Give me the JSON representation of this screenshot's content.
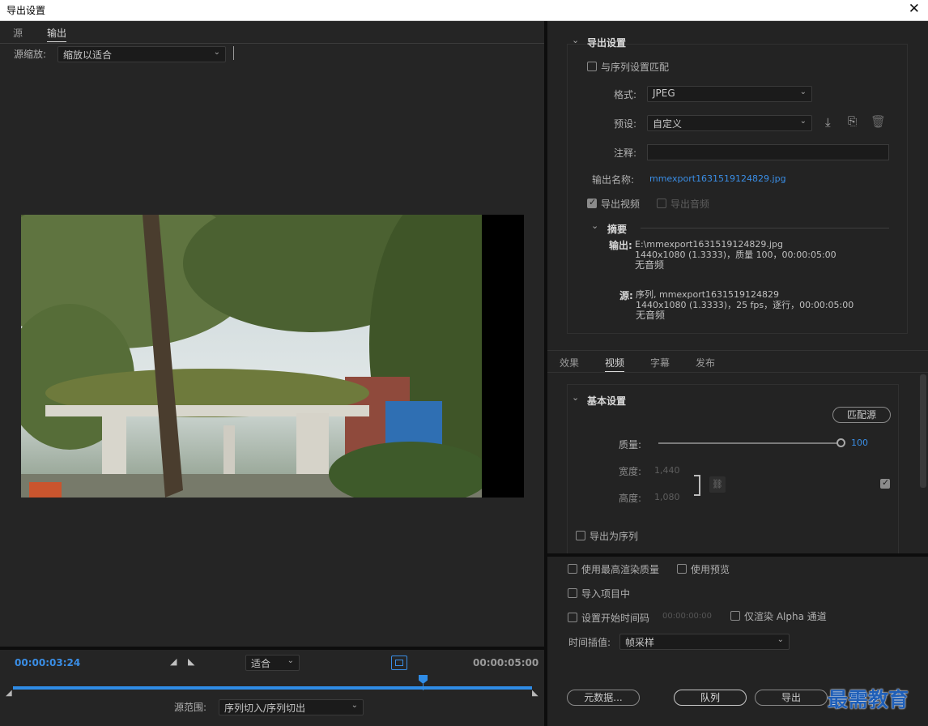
{
  "window": {
    "title": "导出设置",
    "close": "✕"
  },
  "left": {
    "tabs": [
      "源",
      "输出"
    ],
    "source_zoom_label": "源缩放:",
    "source_zoom_value": "缩放以适合",
    "timecode_current": "00:00:03:24",
    "timecode_end": "00:00:05:00",
    "fit_value": "适合",
    "source_range_label": "源范围:",
    "source_range_value": "序列切入/序列切出"
  },
  "export_settings": {
    "title": "导出设置",
    "match_sequence_label": "与序列设置匹配",
    "format_label": "格式:",
    "format_value": "JPEG",
    "preset_label": "预设:",
    "preset_value": "自定义",
    "comment_label": "注释:",
    "comment_value": "",
    "output_name_label": "输出名称:",
    "output_name_value": "mmexport1631519124829.jpg",
    "export_video_label": "导出视频",
    "export_audio_label": "导出音频"
  },
  "summary": {
    "title": "摘要",
    "output_label": "输出:",
    "output_lines": [
      "E:\\mmexport1631519124829.jpg",
      "1440x1080 (1.3333)，质量 100，00:00:05:00",
      "无音频"
    ],
    "source_label": "源:",
    "source_lines": [
      "序列, mmexport1631519124829",
      "1440x1080 (1.3333)，25 fps，逐行，00:00:05:00",
      "无音频"
    ]
  },
  "settings_tabs": [
    "效果",
    "视频",
    "字幕",
    "发布"
  ],
  "basic_settings": {
    "title": "基本设置",
    "match_source_button": "匹配源",
    "quality_label": "质量:",
    "quality_value": "100",
    "quality_fraction": 1.0,
    "width_label": "宽度:",
    "width_value": "1,440",
    "height_label": "高度:",
    "height_value": "1,080",
    "export_as_sequence_label": "导出为序列"
  },
  "bottom": {
    "max_render_quality": "使用最高渲染质量",
    "use_previews": "使用预览",
    "import_into_project": "导入项目中",
    "set_start_timecode": "设置开始时间码",
    "start_timecode_value": "00:00:00:00",
    "render_alpha_only": "仅渲染 Alpha 通道",
    "time_interpolation_label": "时间插值:",
    "time_interpolation_value": "帧采样",
    "metadata_button": "元数据...",
    "queue_button": "队列",
    "export_button": "导出"
  },
  "watermark": "最需教育",
  "colors": {
    "accent": "#3a8ee6",
    "panel": "#232323"
  }
}
